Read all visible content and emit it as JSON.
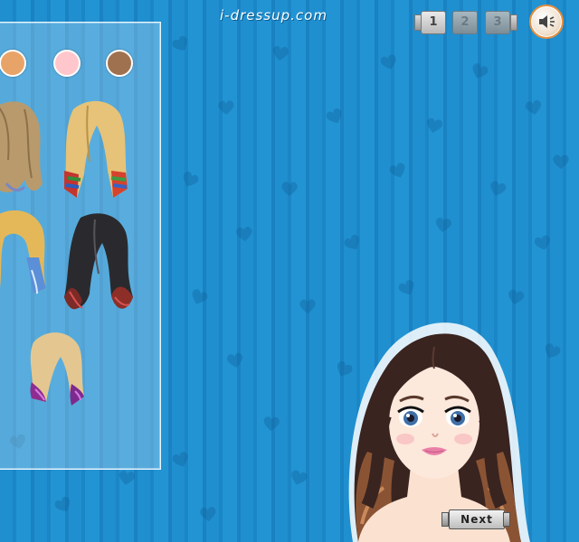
{
  "header": {
    "site_logo": "i-dressup.com"
  },
  "pager": {
    "pages": [
      "1",
      "2",
      "3"
    ],
    "current": "1"
  },
  "sound": {
    "icon": "speaker-icon"
  },
  "panel": {
    "skin_swatches": [
      {
        "name": "tan",
        "color": "#e8a468"
      },
      {
        "name": "pink",
        "color": "#ffc7cc"
      },
      {
        "name": "brown",
        "color": "#a0714e"
      }
    ],
    "hairstyles": [
      {
        "name": "wavy-ash-blonde"
      },
      {
        "name": "blonde-rainbow-tips"
      },
      {
        "name": "blonde-blue-ombre"
      },
      {
        "name": "black-red-ombre"
      },
      {
        "name": "ash-partial"
      },
      {
        "name": "blonde-purple-bob"
      }
    ]
  },
  "footer": {
    "next_label": "Next"
  },
  "colors": {
    "background": "#1f8fd0",
    "panel_border": "#e9f5ff",
    "sound_ring": "#e98f3b"
  }
}
